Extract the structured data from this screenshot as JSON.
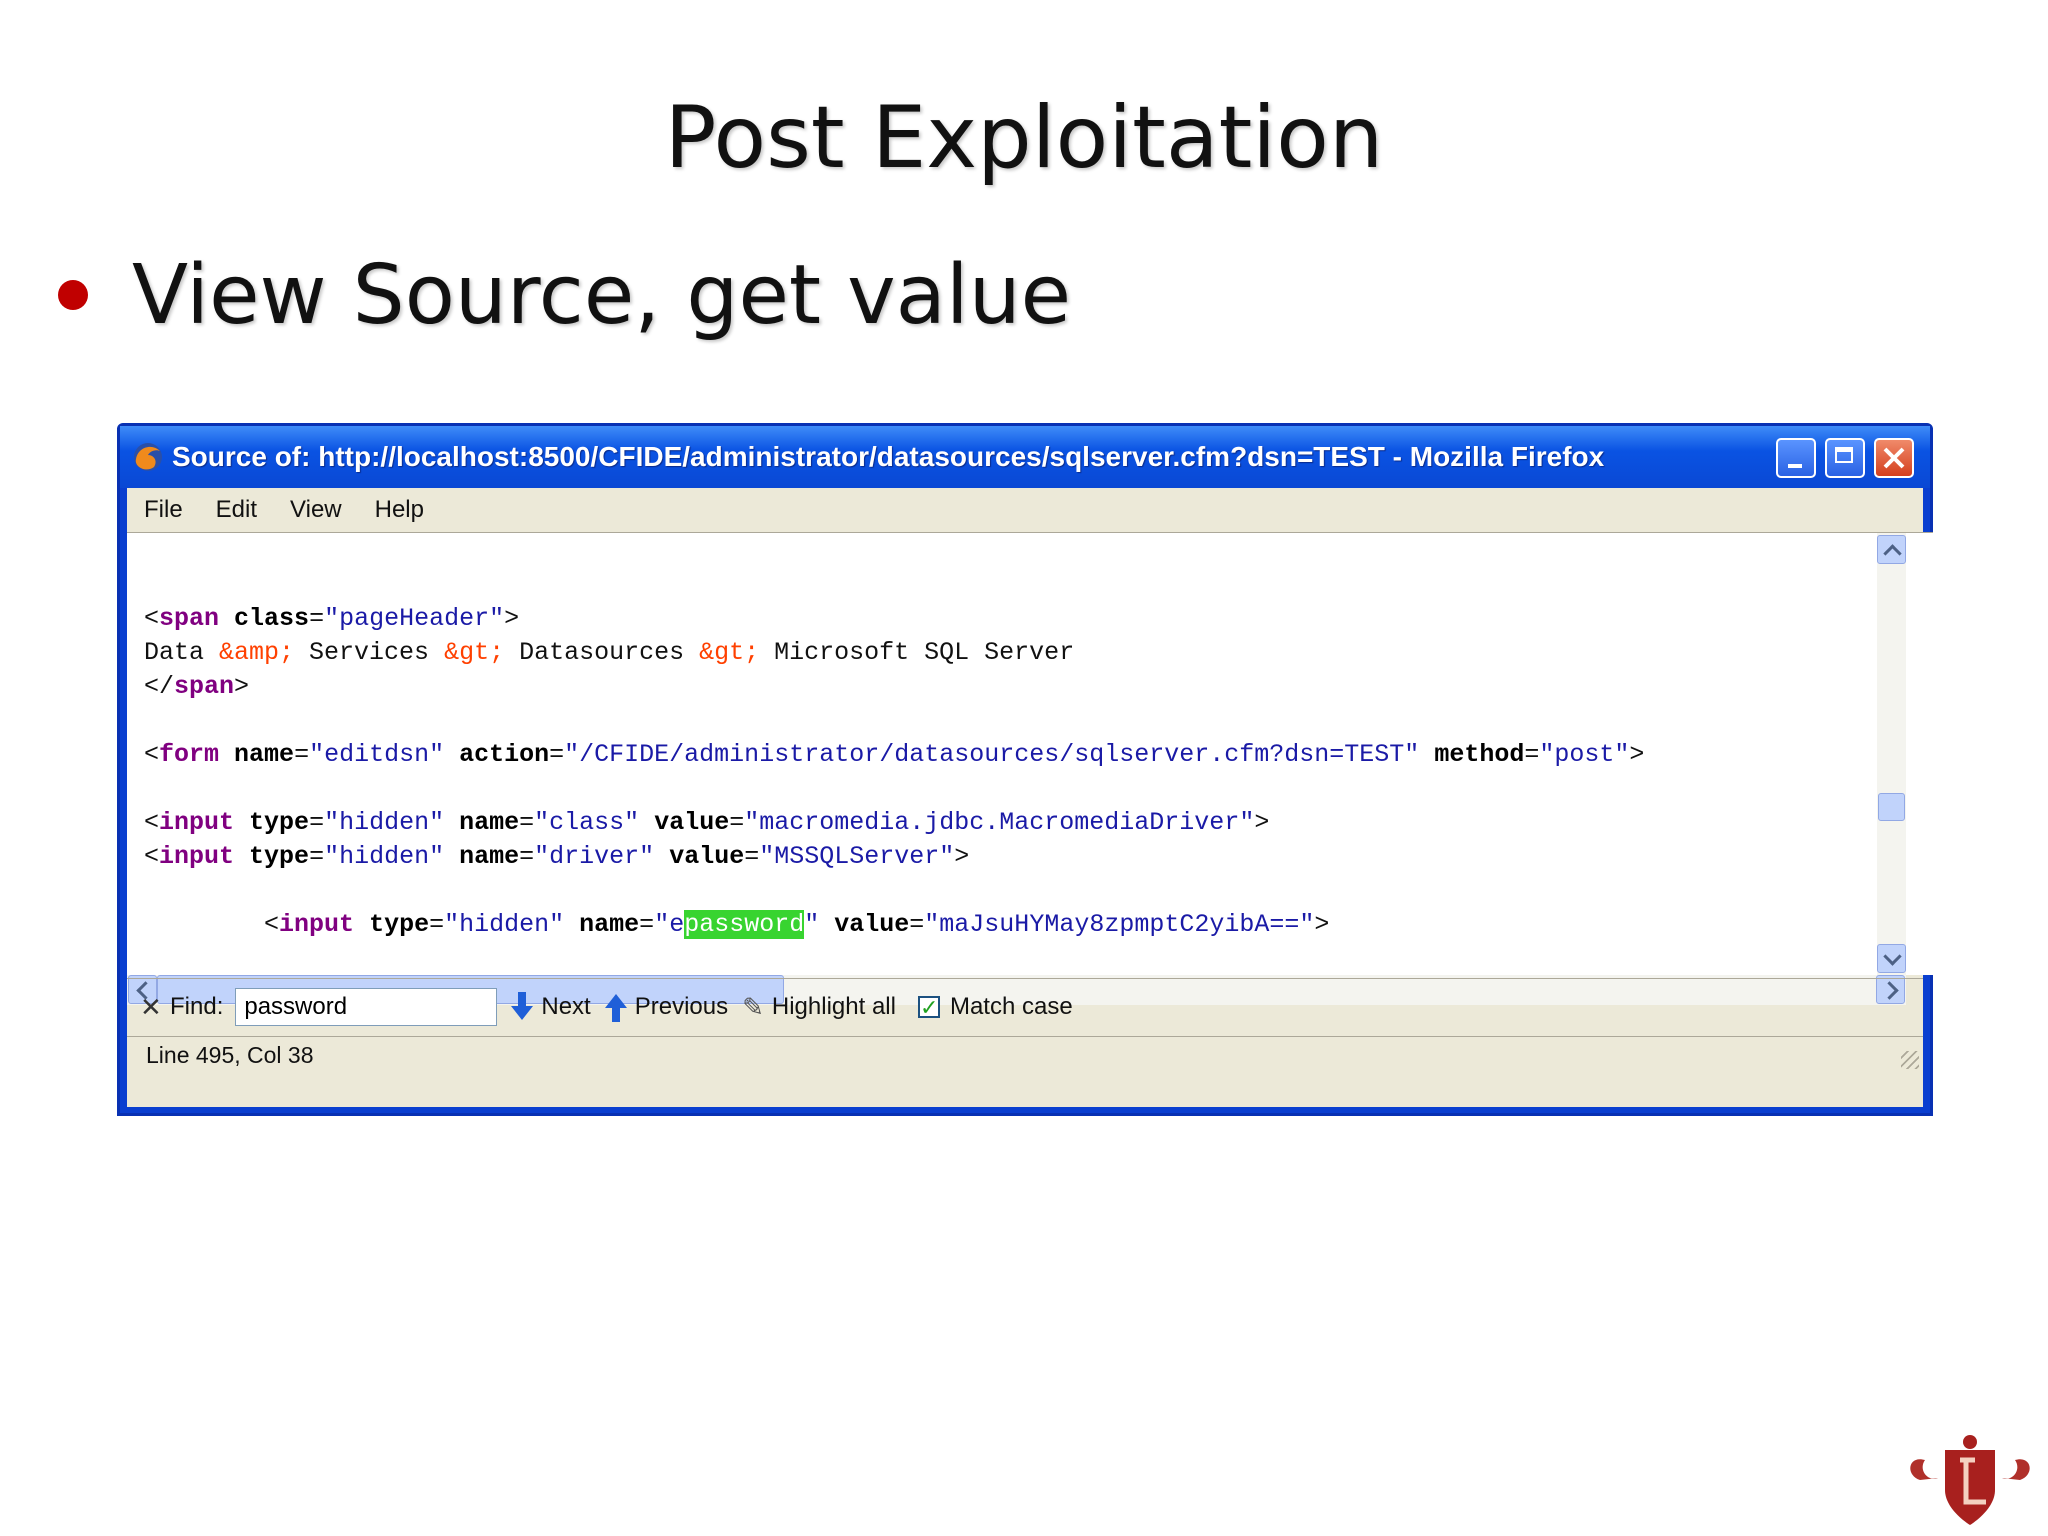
{
  "slide": {
    "title": "Post Exploitation",
    "bullet": "View Source, get value"
  },
  "window": {
    "title": "Source of: http://localhost:8500/CFIDE/administrator/datasources/sqlserver.cfm?dsn=TEST - Mozilla Firefox",
    "menu": [
      "File",
      "Edit",
      "View",
      "Help"
    ]
  },
  "source": {
    "l1": {
      "open": "<",
      "tag": "span",
      "attr": "class",
      "eq": "=",
      "val": "\"pageHeader\"",
      "close": ">"
    },
    "l2": {
      "t1": "Data ",
      "e1": "&amp;",
      "t2": " Services ",
      "e2": "&gt;",
      "t3": " Datasources ",
      "e3": "&gt;",
      "t4": " Microsoft SQL Server"
    },
    "l3": {
      "open": "</",
      "tag": "span",
      "close": ">"
    },
    "l4": {
      "open": "<",
      "tag": "form",
      "a1": "name",
      "v1": "\"editdsn\"",
      "a2": "action",
      "v2": "\"/CFIDE/administrator/datasources/sqlserver.cfm?dsn=TEST\"",
      "a3": "method",
      "v3": "\"post\"",
      "close": ">"
    },
    "l5": {
      "open": "<",
      "tag": "input",
      "a1": "type",
      "v1": "\"hidden\"",
      "a2": "name",
      "v2": "\"class\"",
      "a3": "value",
      "v3": "\"macromedia.jdbc.MacromediaDriver\"",
      "close": ">"
    },
    "l6": {
      "open": "<",
      "tag": "input",
      "a1": "type",
      "v1": "\"hidden\"",
      "a2": "name",
      "v2": "\"driver\"",
      "a3": "value",
      "v3": "\"MSSQLServer\"",
      "close": ">"
    },
    "l7": {
      "indent": "        ",
      "open": "<",
      "tag": "input",
      "a1": "type",
      "v1": "\"hidden\"",
      "a2": "name",
      "v2a": "\"e",
      "v2hl": "password",
      "v2b": "\"",
      "a3": "value",
      "v3": "\"maJsuHYMay8zpmptC2yibA==\"",
      "close": ">"
    }
  },
  "findbar": {
    "close": "✕",
    "label": "Find:",
    "value": "password",
    "next": "Next",
    "previous": "Previous",
    "highlight_all": "Highlight all",
    "match_case": "Match case"
  },
  "status": "Line 495, Col 38",
  "colors": {
    "accent_bullet": "#c00000",
    "titlebar": "#0a53e3",
    "highlight": "#38d430"
  }
}
